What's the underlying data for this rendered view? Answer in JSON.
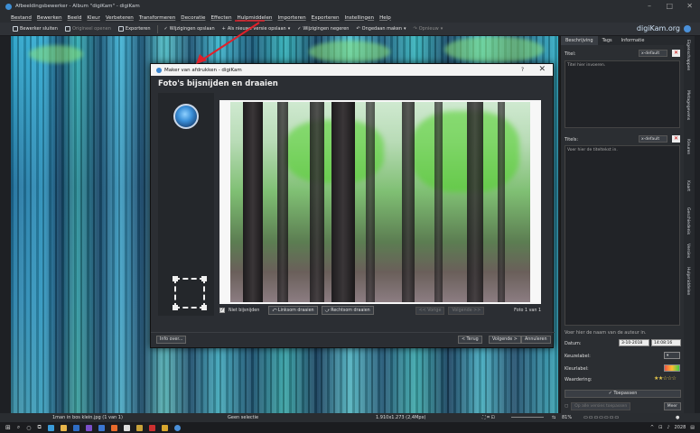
{
  "window": {
    "title": "Afbeeldingsbewerker - Album \"digiKam\" - digiKam"
  },
  "menu": [
    "Bestand",
    "Bewerken",
    "Beeld",
    "Kleur",
    "Verbeteren",
    "Transformeren",
    "Decoratie",
    "Effecten",
    "Hulpmiddelen",
    "Importeren",
    "Exporteren",
    "Instellingen",
    "Help"
  ],
  "toolbar": {
    "close": "Bewerker sluiten",
    "original": "Origineel openen",
    "export": "Exporteren",
    "save": "Wijzigingen opslaan",
    "save_as": "Als nieuwe versie opslaan",
    "discard": "Wijzigingen negeren",
    "undo": "Ongedaan maken",
    "redo": "Opnieuw",
    "brand": "digiKam.org"
  },
  "right_panel": {
    "tabs": [
      "Beschrijving",
      "Tags",
      "Informatie"
    ],
    "title_label": "Titel:",
    "title_lang": "x-default",
    "title_placeholder": "Titel hier invoeren.",
    "caption_label": "Titels:",
    "caption_lang": "x-default",
    "caption_placeholder": "Voer hier de titeltekst in.",
    "author_placeholder": "Voer hier de naam van de auteur in.",
    "date_label": "Datum:",
    "date_value": "3-10-2018",
    "time_value": "14:08:16",
    "pick_label": "Keuzelabel:",
    "color_label": "Kleurlabel:",
    "rating_label": "Waardering:",
    "apply": "Toepassen",
    "apply_all": "Op alle versies toepassen",
    "more": "Meer"
  },
  "side_tabs": [
    "Eigenschappen",
    "Metagegevens",
    "Kleuren",
    "Kaart",
    "Geschiedenis",
    "Versies",
    "Hulpmiddelen"
  ],
  "dialog": {
    "title": "Maker van afdrukken - digiKam",
    "help": "?",
    "heading": "Foto's bijsnijden en draaien",
    "no_crop": "Niet bijsnijden",
    "rotate_left": "Linksom draaien",
    "rotate_right": "Rechtsom draaien",
    "prev": "<< Vorige",
    "next": "Volgende >>",
    "photo_count": "Foto 1 van 1",
    "info": "Info over...",
    "back": "< Terug",
    "forward": "Volgende >",
    "cancel": "Annuleren"
  },
  "status": {
    "file": "1man in bos klein.jpg (1 van 1)",
    "selection": "Geen selectie",
    "dimensions": "1.910x1.273 (2,4Mpx)",
    "zoom": "81%"
  },
  "taskbar": {
    "time": "2028"
  },
  "colors": {
    "accent": "#3d8fd6",
    "arrow": "#e0202a",
    "star": "#e6c84a"
  }
}
